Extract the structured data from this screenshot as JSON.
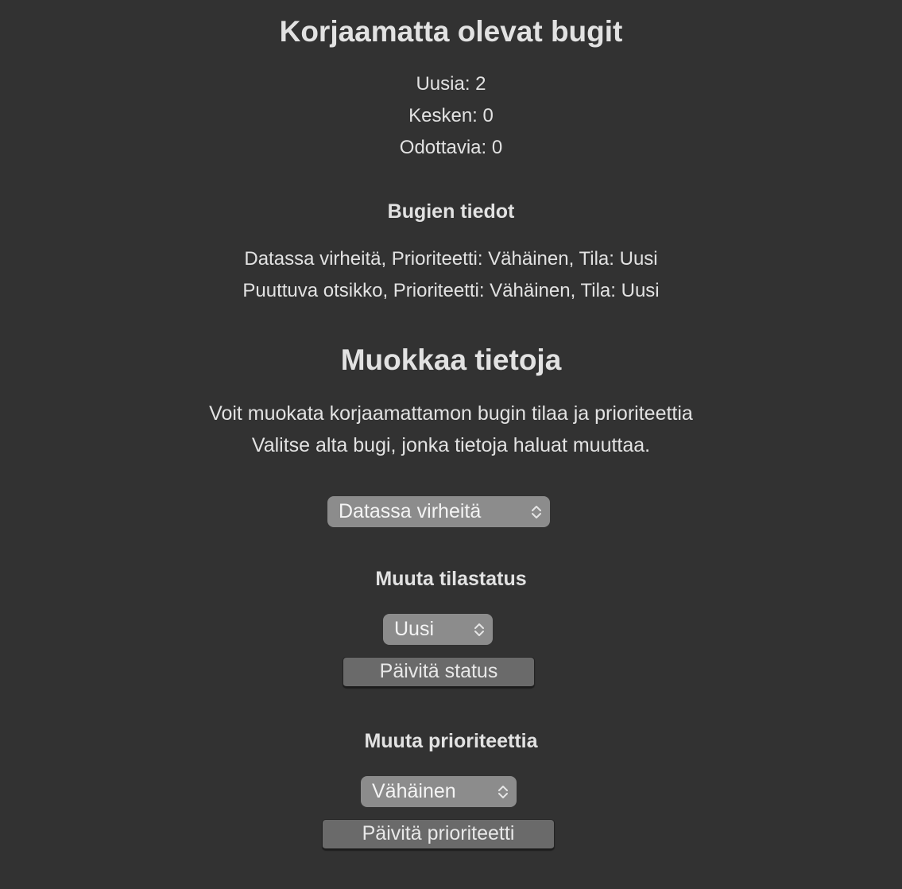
{
  "summary": {
    "title": "Korjaamatta olevat bugit",
    "new_count": "Uusia: 2",
    "in_progress_count": "Kesken: 0",
    "waiting_count": "Odottavia: 0"
  },
  "details": {
    "heading": "Bugien tiedot",
    "bugs": [
      "Datassa virheitä, Prioriteetti: Vähäinen, Tila: Uusi",
      "Puuttuva otsikko, Prioriteetti: Vähäinen, Tila: Uusi"
    ]
  },
  "edit": {
    "title": "Muokkaa tietoja",
    "description_line1": "Voit muokata korjaamattamon bugin tilaa ja prioriteettia",
    "description_line2": "Valitse alta bugi, jonka tietoja haluat muuttaa.",
    "bug_select": {
      "selected": "Datassa virheitä",
      "icon": "chevron-up-down-icon"
    },
    "status_section": {
      "heading": "Muuta tilastatus",
      "select": {
        "selected": "Uusi",
        "icon": "chevron-up-down-icon"
      },
      "button_label": "Päivitä status"
    },
    "priority_section": {
      "heading": "Muuta prioriteettia",
      "select": {
        "selected": "Vähäinen",
        "icon": "chevron-up-down-icon"
      },
      "button_label": "Päivitä prioriteetti"
    }
  },
  "colors": {
    "background": "#323232",
    "text": "#e2e2e2",
    "select_bg": "#8c8c8c",
    "button_bg": "#6a6a6a"
  }
}
